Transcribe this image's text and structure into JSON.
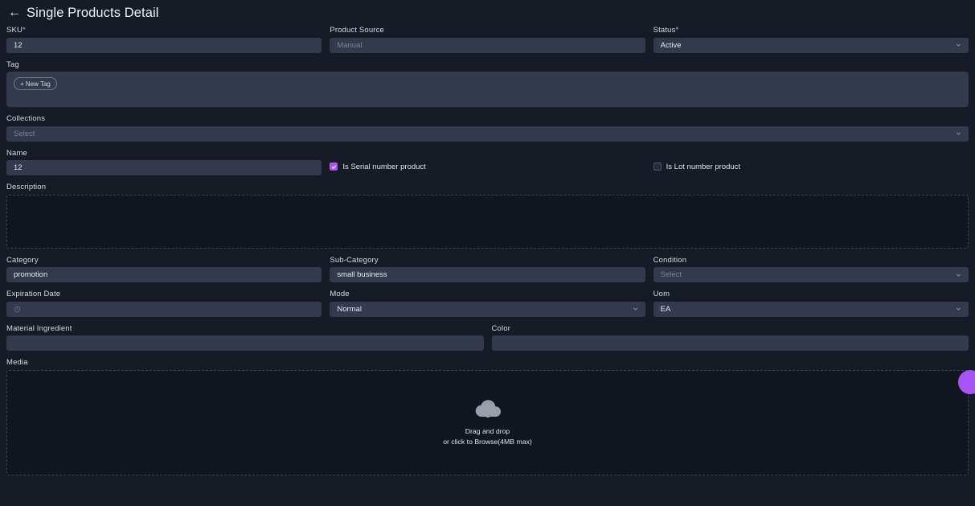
{
  "header": {
    "back_icon": "arrow-left-icon",
    "title": "Single Products Detail"
  },
  "form": {
    "sku": {
      "label": "SKU",
      "required_mark": "*",
      "value": "12"
    },
    "product_source": {
      "label": "Product Source",
      "placeholder": "Manual",
      "value": ""
    },
    "status": {
      "label": "Status",
      "required_mark": "*",
      "value": "Active",
      "icon": "chevron-down-icon"
    },
    "tag": {
      "label": "Tag",
      "new_tag_label": "+ New Tag"
    },
    "collections": {
      "label": "Collections",
      "placeholder": "Select",
      "value": "",
      "icon": "chevron-down-icon"
    },
    "name": {
      "label": "Name",
      "value": "12"
    },
    "is_serial_number_product": {
      "label": "Is Serial number product",
      "checked": true
    },
    "is_lot_number_product": {
      "label": "Is Lot number product",
      "checked": false
    },
    "description": {
      "label": "Description",
      "value": ""
    },
    "category": {
      "label": "Category",
      "value": "promotion"
    },
    "sub_category": {
      "label": "Sub-Category",
      "value": "small business"
    },
    "condition": {
      "label": "Condition",
      "placeholder": "Select",
      "value": "",
      "icon": "chevron-down-icon"
    },
    "expiration_date": {
      "label": "Expiration Date",
      "value": "",
      "icon": "clock-icon"
    },
    "mode": {
      "label": "Mode",
      "value": "Normal",
      "icon": "chevron-down-icon"
    },
    "uom": {
      "label": "Uom",
      "value": "EA",
      "icon": "chevron-down-icon"
    },
    "material_ingredient": {
      "label": "Material Ingredient",
      "value": ""
    },
    "color": {
      "label": "Color",
      "value": ""
    },
    "media": {
      "label": "Media",
      "icon": "cloud-upload-icon",
      "line1": "Drag and drop",
      "line2": "or click to Browse(4MB max)"
    }
  },
  "fab": {
    "name": "floating-action-button"
  },
  "colors": {
    "page_background": "#161b26",
    "input_background": "#333a4b",
    "accent_purple": "#a855f7",
    "dashed_border": "#3c4458",
    "text_primary": "#e6e8ee",
    "text_placeholder": "#7d8494"
  }
}
